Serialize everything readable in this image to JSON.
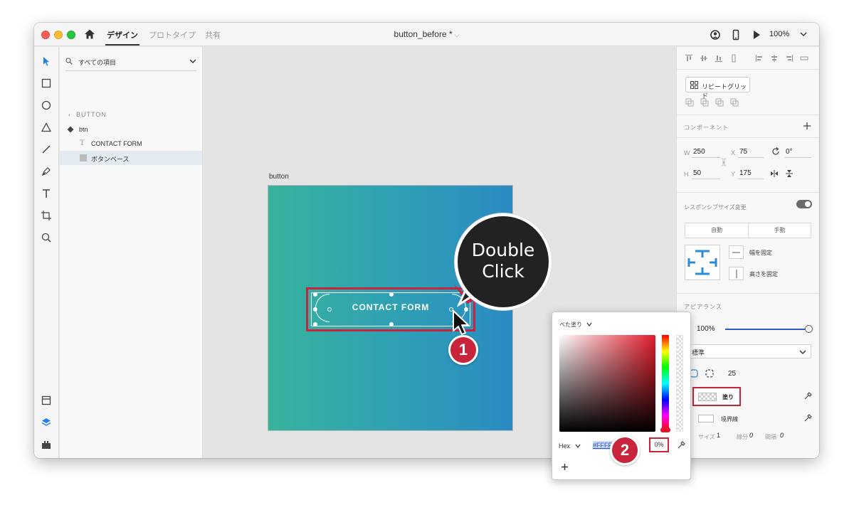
{
  "titlebar": {
    "tabs": [
      {
        "label": "デザイン",
        "active": true
      },
      {
        "label": "プロトタイプ",
        "active": false
      },
      {
        "label": "共有",
        "active": false
      }
    ],
    "document_title": "button_before *",
    "zoom": "100%"
  },
  "layers": {
    "search_scope": "すべての項目",
    "breadcrumb": "BUTTON",
    "items": [
      {
        "label": "btn",
        "type": "component"
      },
      {
        "label": "CONTACT FORM",
        "type": "text"
      },
      {
        "label": "ボタンベース",
        "type": "rectangle"
      }
    ]
  },
  "canvas": {
    "artboard_name": "button",
    "button_text": "CONTACT FORM",
    "callout": {
      "line1": "Double",
      "line2": "Click"
    },
    "markers": [
      "1",
      "2"
    ]
  },
  "properties": {
    "repeat_grid": "リピートグリッド",
    "component_section": "コンポーネント",
    "transform": {
      "w_label": "W",
      "w": "250",
      "h_label": "H",
      "h": "50",
      "x_label": "X",
      "x": "75",
      "y_label": "Y",
      "y": "175",
      "rotation": "0°"
    },
    "responsive": {
      "title": "レスポンシブサイズ変更",
      "enabled": true,
      "auto": "自動",
      "manual": "手動",
      "fix_width": "幅を固定",
      "fix_height": "高さを固定"
    },
    "appearance": {
      "title": "アピアランス",
      "opacity": "100%",
      "opacity_fraction": 1.0,
      "blend_mode": "標準",
      "corner_radius": "25",
      "fill_label": "塗り",
      "border_label": "境界線",
      "size_label": "サイズ",
      "size_value": "1",
      "dash_label": "線分",
      "dash_value": "0",
      "gap_label": "間隔",
      "gap_value": "0"
    }
  },
  "color_picker": {
    "fill_type": "べた塗り",
    "mode": "Hex",
    "hex_value": "#FFFFFF",
    "alpha": "0%"
  },
  "colors": {
    "highlight_red": "#c8243b",
    "accent_blue": "#2c5cc7",
    "artboard_gradient_start": "#37b39d",
    "artboard_gradient_end": "#2a8bc3"
  }
}
